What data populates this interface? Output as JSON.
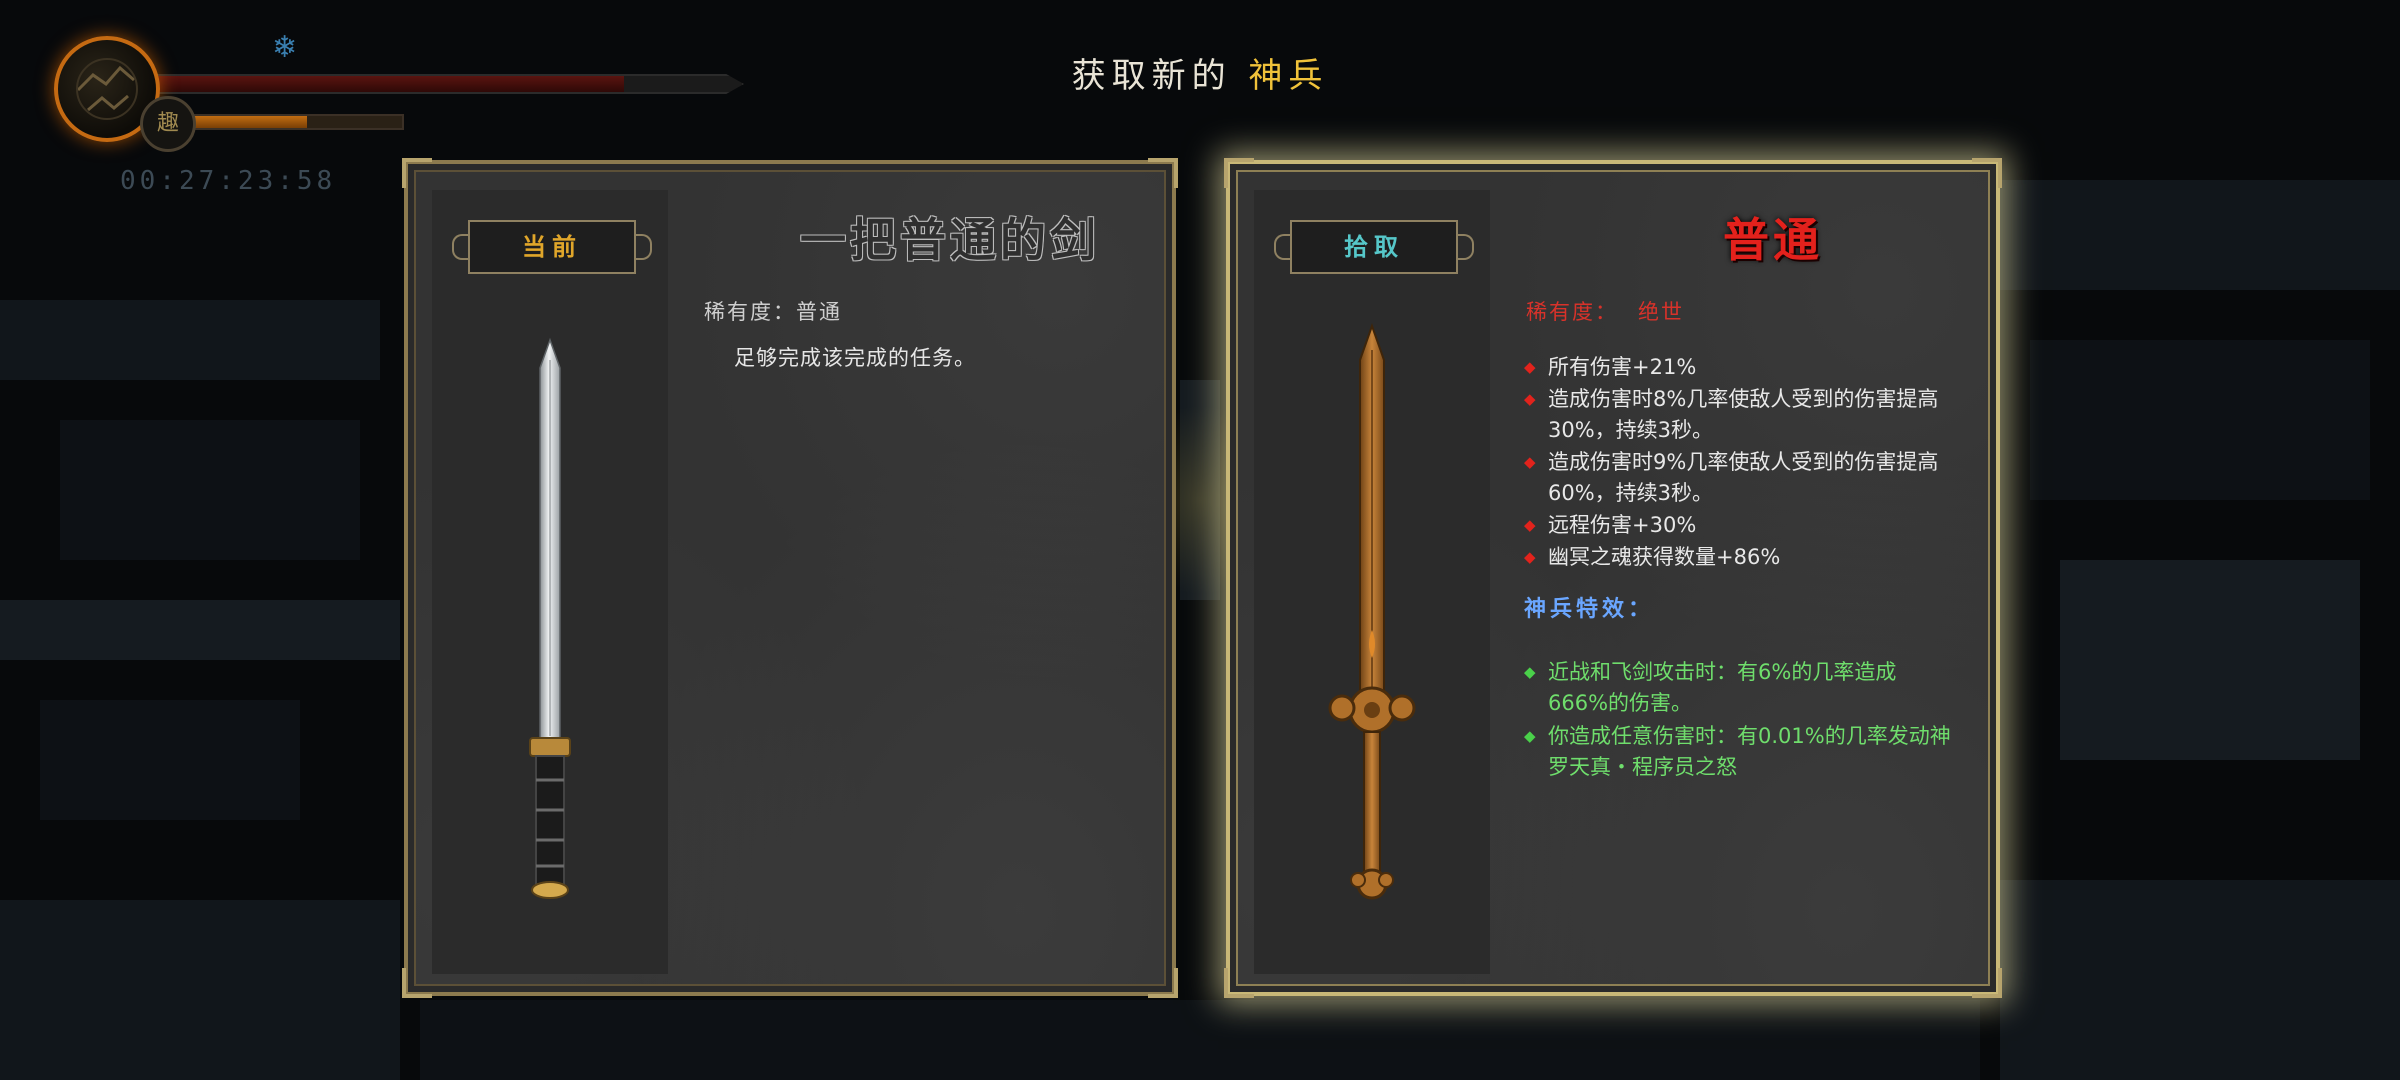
{
  "hud": {
    "timer": "00:27:23:58",
    "hp_fraction": 0.8,
    "energy_fraction": 0.62,
    "badge_char": "趣",
    "icons": [
      "portrait-icon",
      "snowflake-icon"
    ]
  },
  "title": {
    "prefix": "获取新的",
    "highlight": "神兵"
  },
  "current_weapon": {
    "tag": "当前",
    "name": "一把普通的剑",
    "rarity_label": "稀有度：普通",
    "description": "足够完成该完成的任务。"
  },
  "new_weapon": {
    "tag": "拾取",
    "name": "普通",
    "rarity_label": "稀有度：",
    "rarity_value": "绝世",
    "stats": [
      "所有伤害+21%",
      "造成伤害时8%几率使敌人受到的伤害提高30%，持续3秒。",
      "造成伤害时9%几率使敌人受到的伤害提高60%，持续3秒。",
      "远程伤害+30%",
      "幽冥之魂获得数量+86%"
    ],
    "special_heading": "神兵特效：",
    "special_effects": [
      "近战和飞剑攻击时：有6%的几率造成666%的伤害。",
      "你造成任意伤害时：有0.01%的几率发动神罗天真・程序员之怒"
    ]
  },
  "colors": {
    "gold": "#f0c23a",
    "rarity_red": "#e3211c",
    "special_blue": "#6aa6ff",
    "effect_green": "#6fde6c",
    "pickup_cyan": "#56c7c9"
  }
}
